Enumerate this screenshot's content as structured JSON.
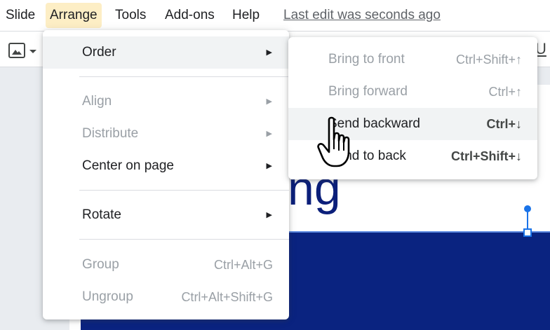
{
  "menubar": {
    "items": [
      {
        "label": "Slide",
        "active": false
      },
      {
        "label": "Arrange",
        "active": true
      },
      {
        "label": "Tools",
        "active": false
      },
      {
        "label": "Add-ons",
        "active": false
      },
      {
        "label": "Help",
        "active": false
      }
    ],
    "last_edit": "Last edit was seconds ago"
  },
  "toolbar": {
    "icons": [
      "insert-image-icon",
      "dropdown-caret-icon",
      "underline-icon"
    ],
    "underline_glyph": "U"
  },
  "slide": {
    "title_fragment": "ng",
    "title_color": "#0b1f7a",
    "shape_color": "#0a2380",
    "selection_color": "#1a73e8"
  },
  "arrange_menu": {
    "items": [
      {
        "label": "Order",
        "enabled": true,
        "submenu": true,
        "shortcut": ""
      },
      {
        "label": "Align",
        "enabled": false,
        "submenu": true,
        "shortcut": ""
      },
      {
        "label": "Distribute",
        "enabled": false,
        "submenu": true,
        "shortcut": ""
      },
      {
        "label": "Center on page",
        "enabled": true,
        "submenu": true,
        "shortcut": ""
      },
      {
        "label": "Rotate",
        "enabled": true,
        "submenu": true,
        "shortcut": ""
      },
      {
        "label": "Group",
        "enabled": false,
        "submenu": false,
        "shortcut": "Ctrl+Alt+G"
      },
      {
        "label": "Ungroup",
        "enabled": false,
        "submenu": false,
        "shortcut": "Ctrl+Alt+Shift+G"
      }
    ],
    "submenu_arrow": "▶"
  },
  "order_menu": {
    "items": [
      {
        "label": "Bring to front",
        "shortcut": "Ctrl+Shift+↑",
        "enabled": false
      },
      {
        "label": "Bring forward",
        "shortcut": "Ctrl+↑",
        "enabled": false
      },
      {
        "label": "Send backward",
        "shortcut": "Ctrl+↓",
        "enabled": true,
        "hovered": true
      },
      {
        "label": "Send to back",
        "shortcut": "Ctrl+Shift+↓",
        "enabled": true
      }
    ]
  },
  "colors": {
    "active_menu_bg": "#fdeec5",
    "hover_bg": "#f1f3f4",
    "disabled_text": "#9aa0a6"
  }
}
